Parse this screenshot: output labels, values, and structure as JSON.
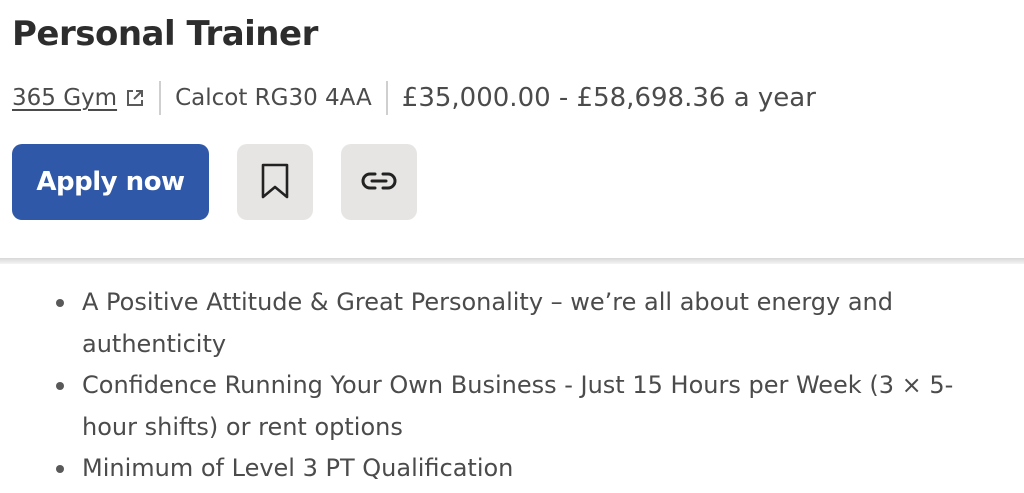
{
  "job": {
    "title": "Personal Trainer",
    "company": "365 Gym",
    "location": "Calcot RG30 4AA",
    "salary": "£35,000.00 - £58,698.36 a year"
  },
  "actions": {
    "apply_label": "Apply now",
    "save_icon": "bookmark-icon",
    "copy_link_icon": "link-icon"
  },
  "description": {
    "bullets": [
      "A Positive Attitude & Great Personality – we’re all about energy and authenticity",
      "Confidence Running Your Own Business - Just 15 Hours per Week (3 × 5-hour shifts) or rent options",
      "Minimum of Level 3 PT Qualification"
    ]
  },
  "colors": {
    "primary": "#2f58a8",
    "icon_button_bg": "#e6e5e3",
    "text": "#2d2d2d"
  }
}
